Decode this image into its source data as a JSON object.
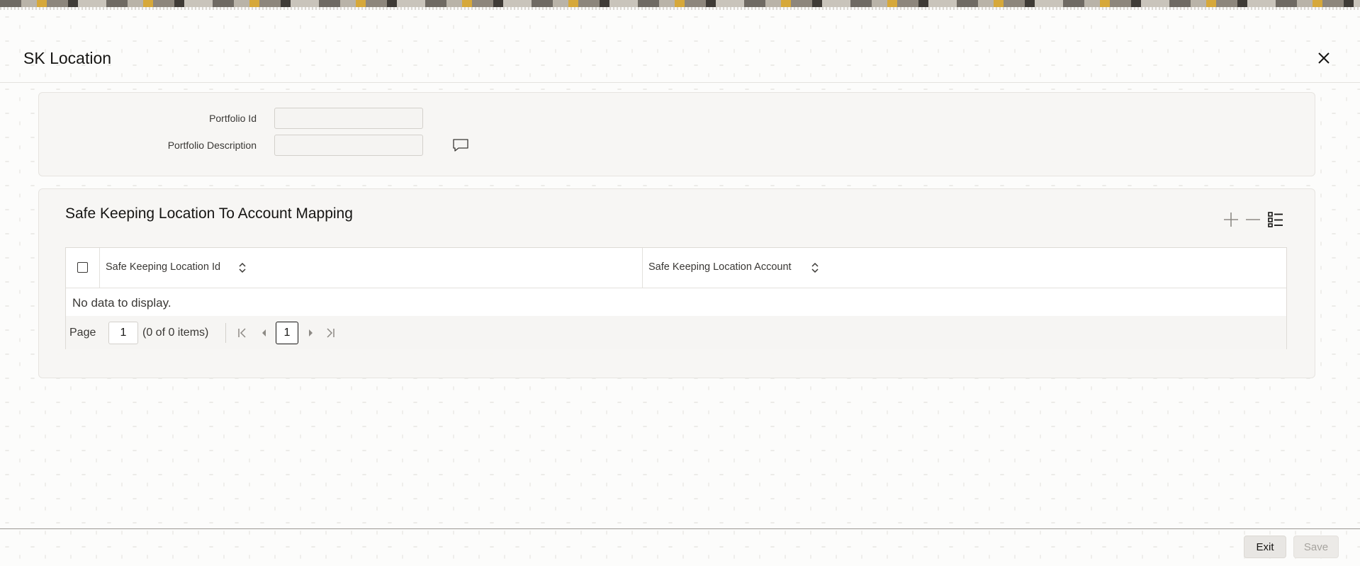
{
  "window": {
    "title": "SK Location"
  },
  "form": {
    "portfolio_id_label": "Portfolio Id",
    "portfolio_id_value": "",
    "portfolio_desc_label": "Portfolio Description",
    "portfolio_desc_value": ""
  },
  "mapping": {
    "title": "Safe Keeping Location To Account Mapping",
    "columns": [
      "Safe Keeping Location Id",
      "Safe Keeping Location Account"
    ],
    "empty_text": "No data to display.",
    "pager": {
      "page_label": "Page",
      "page_value": "1",
      "items_text": "(0 of 0 items)",
      "current_page": "1"
    }
  },
  "footer": {
    "exit_label": "Exit",
    "save_label": "Save"
  },
  "icons": {
    "close": "close-icon",
    "description": "comment-icon",
    "add": "plus-icon",
    "delete": "minus-icon",
    "view": "list-icon",
    "sort": "sort-icon",
    "pager": [
      "first-page-icon",
      "prev-page-icon",
      "next-page-icon",
      "last-page-icon"
    ]
  },
  "colors": {
    "text": "#161513",
    "muted": "#3a3835",
    "border": "#d3d0cb",
    "disabled": "#a6a39e"
  }
}
